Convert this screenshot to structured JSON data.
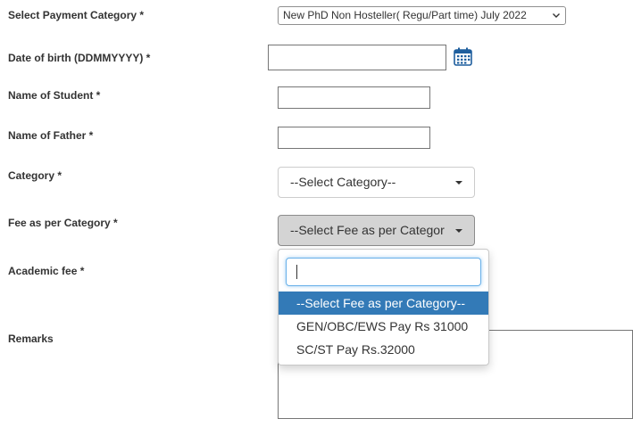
{
  "labels": {
    "payment_category": "Select Payment Category *",
    "dob": "Date of birth (DDMMYYYY) *",
    "student_name": "Name of Student *",
    "father_name": "Name of Father *",
    "category": "Category *",
    "fee_category": "Fee as per Category *",
    "academic_fee": "Academic fee *",
    "remarks": "Remarks"
  },
  "payment_category_select": {
    "value": "New PhD Non Hosteller( Regu/Part time) July 2022"
  },
  "category_select": {
    "value": "--Select Category--"
  },
  "fee_select": {
    "value": "--Select Fee as per Categor",
    "options": [
      "--Select Fee as per Category--",
      "GEN/OBC/EWS Pay Rs 31000",
      "SC/ST Pay Rs.32000"
    ]
  },
  "icons": {
    "calendar": "calendar-icon",
    "chevron": "chevron-down-icon",
    "caret": "caret-down-icon"
  },
  "colors": {
    "highlight": "#337ab7",
    "focus_border": "#66afe9",
    "active_button": "#d4d4d4"
  }
}
